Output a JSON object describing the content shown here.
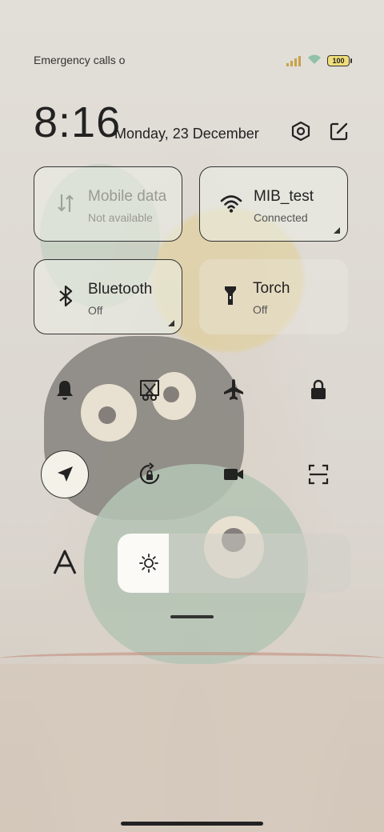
{
  "status_bar": {
    "carrier_text": "Emergency calls o",
    "battery_level": "100"
  },
  "clock": {
    "time": "8:16",
    "date": "Monday, 23 December"
  },
  "header_icons": [
    "settings-hexagon-icon",
    "edit-icon"
  ],
  "tiles": [
    {
      "id": "mobile-data",
      "label": "Mobile data",
      "state": "Not available",
      "icon": "mobile-data-icon",
      "enabled": false
    },
    {
      "id": "wifi",
      "label": "MIB_test",
      "state": "Connected",
      "icon": "wifi-icon",
      "enabled": true
    },
    {
      "id": "bluetooth",
      "label": "Bluetooth",
      "state": "Off",
      "icon": "bluetooth-icon",
      "enabled": true
    },
    {
      "id": "torch",
      "label": "Torch",
      "state": "Off",
      "icon": "torch-icon",
      "enabled": true
    }
  ],
  "toggles_row1": [
    {
      "id": "sound",
      "icon": "bell-icon",
      "active": false
    },
    {
      "id": "screenshot",
      "icon": "scissors-screenshot-icon",
      "active": false
    },
    {
      "id": "airplane",
      "icon": "airplane-icon",
      "active": false
    },
    {
      "id": "lock",
      "icon": "lock-icon",
      "active": false
    }
  ],
  "toggles_row2": [
    {
      "id": "location",
      "icon": "location-arrow-icon",
      "active": true
    },
    {
      "id": "rotation-lock",
      "icon": "rotation-lock-icon",
      "active": false
    },
    {
      "id": "screen-recorder",
      "icon": "video-camera-icon",
      "active": false
    },
    {
      "id": "scanner",
      "icon": "scan-frame-icon",
      "active": false
    }
  ],
  "brightness": {
    "level": 0.22,
    "icon": "sun-icon"
  },
  "font_size_icon": "font-a-icon",
  "colors": {
    "text": "#222222",
    "tile_border": "#333333",
    "battery_fill": "#f0de7a",
    "brightness_fill": "#fbfaf7"
  }
}
